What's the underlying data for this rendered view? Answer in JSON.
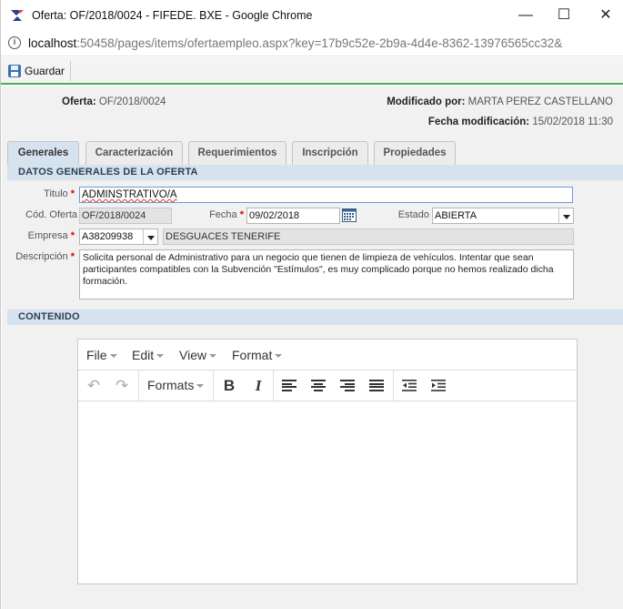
{
  "window": {
    "title": "Oferta: OF/2018/0024 - FIFEDE. BXE - Google Chrome",
    "url_host": "localhost",
    "url_path": ":50458/pages/items/ofertaempleo.aspx?key=17b9c52e-2b9a-4d4e-8362-13976565cc32&"
  },
  "toolbar": {
    "save_label": "Guardar"
  },
  "header": {
    "oferta_label": "Oferta:",
    "oferta_value": "OF/2018/0024",
    "modificado_label": "Modificado por:",
    "modificado_value": "MARTA PEREZ CASTELLANO",
    "fecha_mod_label": "Fecha modificación:",
    "fecha_mod_value": "15/02/2018 11:30"
  },
  "tabs": [
    {
      "label": "Generales",
      "active": true
    },
    {
      "label": "Caracterización"
    },
    {
      "label": "Requerimientos"
    },
    {
      "label": "Inscripción"
    },
    {
      "label": "Propiedades"
    }
  ],
  "sections": {
    "general": "DATOS GENERALES DE LA OFERTA",
    "contenido": "CONTENIDO"
  },
  "form": {
    "titulo_label": "Titulo",
    "titulo_value": "ADMINSTRATIVO/A",
    "cod_label": "Cód. Oferta",
    "cod_value": "OF/2018/0024",
    "fecha_label": "Fecha",
    "fecha_value": "09/02/2018",
    "estado_label": "Estado",
    "estado_value": "ABIERTA",
    "empresa_label": "Empresa",
    "empresa_code": "A38209938",
    "empresa_name": "DESGUACES TENERIFE",
    "descripcion_label": "Descripción",
    "descripcion_value": "Solicita personal de Administrativo para un negocio que tienen de limpieza de vehículos. Intentar que sean participantes compatibles con la Subvención \"Estímulos\", es muy complicado porque no hemos realizado dicha formación.",
    "required_mark": "*"
  },
  "editor": {
    "menus": [
      "File",
      "Edit",
      "View",
      "Format"
    ],
    "formats_label": "Formats"
  }
}
